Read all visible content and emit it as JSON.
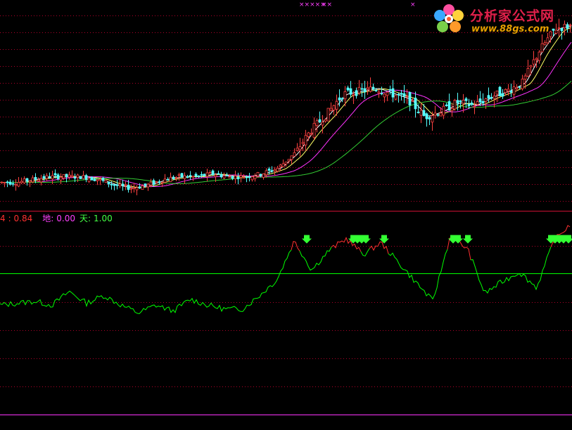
{
  "colors": {
    "grid_red": "#b0002a",
    "separator": "#cc1133",
    "k_line": "#ff3030",
    "d_line": "#ff40ff",
    "threshold_line": "#00ff00",
    "arrow": "#33ff33",
    "ma_white": "#ffffff",
    "ma_yellow": "#ffff66",
    "ma_magenta": "#ff33ff",
    "ma_green": "#33cc33",
    "candle_up": "#ff4040",
    "candle_down": "#55ffff",
    "bottom_line": "#ff33ff"
  },
  "logo": {
    "title": "分析家公式网",
    "url": "www.88gs.com",
    "icon": "flower-logo-icon"
  },
  "top_marks": [
    "×××××",
    "××",
    "×"
  ],
  "indicator_legend": {
    "item1_label": "4",
    "item1_value": ": 0.84",
    "item2_label": "地:",
    "item2_value": "0.00",
    "item3_label": "天:",
    "item3_value": "1.00"
  },
  "chart_data": [
    {
      "type": "line",
      "panel": "price-candlestick",
      "series": [
        {
          "values": [
            48,
            48,
            49,
            50,
            50,
            50,
            49,
            47,
            46,
            47,
            49,
            50,
            50,
            51,
            50,
            50,
            51,
            53,
            58,
            66,
            72,
            79,
            80,
            81,
            79,
            77,
            71,
            73,
            76,
            75,
            78,
            80,
            83,
            94,
            102,
            103
          ]
        }
      ]
    },
    {
      "type": "line",
      "panel": "oscillator",
      "ylim": [
        0,
        1
      ],
      "reference_lines": [
        0.84
      ],
      "series": [
        {
          "values": [
            0.56,
            0.57,
            0.58,
            0.56,
            0.63,
            0.57,
            0.61,
            0.56,
            0.52,
            0.56,
            0.53,
            0.59,
            0.56,
            0.54,
            0.54,
            0.61,
            0.69,
            0.89,
            0.74,
            0.84,
            0.9,
            0.82,
            0.88,
            0.78,
            0.68,
            0.58,
            0.91,
            0.85,
            0.62,
            0.68,
            0.73,
            0.65,
            0.89,
            0.98
          ]
        }
      ],
      "signals": [
        "x=436",
        "x=502",
        "x=508",
        "x=514",
        "x=520",
        "x=546",
        "x=644",
        "x=651",
        "x=665",
        "x=783",
        "x=789",
        "x=795",
        "x=801",
        "x=808"
      ]
    }
  ]
}
